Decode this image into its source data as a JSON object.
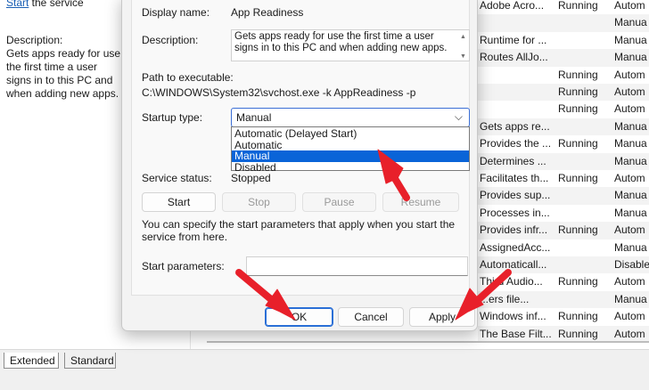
{
  "background": {
    "left_pane": {
      "start_link": "Start",
      "start_rest": " the service",
      "description_label": "Description:",
      "description_text": "Gets apps ready for use the first time a user signs in to this PC and when adding new apps."
    },
    "services_rows": [
      {
        "name": "Adobe Acro...",
        "status": "Running",
        "startup": "Autom"
      },
      {
        "name": "",
        "status": "",
        "startup": "Manua"
      },
      {
        "name": "Runtime for ...",
        "status": "",
        "startup": "Manua"
      },
      {
        "name": "Routes AllJo...",
        "status": "",
        "startup": "Manua"
      },
      {
        "name": "",
        "status": "Running",
        "startup": "Autom"
      },
      {
        "name": "",
        "status": "Running",
        "startup": "Autom"
      },
      {
        "name": "",
        "status": "Running",
        "startup": "Autom"
      },
      {
        "name": "Gets apps re...",
        "status": "",
        "startup": "Manua"
      },
      {
        "name": "Provides the ...",
        "status": "Running",
        "startup": "Manua"
      },
      {
        "name": "Determines ...",
        "status": "",
        "startup": "Manua"
      },
      {
        "name": "Facilitates th...",
        "status": "Running",
        "startup": "Autom"
      },
      {
        "name": "Provides sup...",
        "status": "",
        "startup": "Manua"
      },
      {
        "name": "Processes in...",
        "status": "",
        "startup": "Manua"
      },
      {
        "name": "Provides infr...",
        "status": "Running",
        "startup": "Autom"
      },
      {
        "name": "AssignedAcc...",
        "status": "",
        "startup": "Manua"
      },
      {
        "name": "Automaticall...",
        "status": "",
        "startup": "Disable"
      },
      {
        "name": "Third Audio...",
        "status": "Running",
        "startup": "Autom"
      },
      {
        "name": "...ers file...",
        "status": "",
        "startup": "Manua"
      },
      {
        "name": "Windows inf...",
        "status": "Running",
        "startup": "Autom"
      },
      {
        "name": "The Base Filt...",
        "status": "Running",
        "startup": "Autom"
      }
    ],
    "tabs": [
      "Extended",
      "Standard"
    ]
  },
  "dialog": {
    "display_name_label": "Display name:",
    "display_name_value": "App Readiness",
    "description_label": "Description:",
    "description_value": "Gets apps ready for use the first time a user signs in to this PC and when adding new apps.",
    "path_label": "Path to executable:",
    "path_value": "C:\\WINDOWS\\System32\\svchost.exe -k AppReadiness -p",
    "startup_type_label": "Startup type:",
    "startup_type_value": "Manual",
    "startup_options": [
      "Automatic (Delayed Start)",
      "Automatic",
      "Manual",
      "Disabled"
    ],
    "selected_option": "Manual",
    "service_status_label": "Service status:",
    "service_status_value": "Stopped",
    "buttons": {
      "start": "Start",
      "stop": "Stop",
      "pause": "Pause",
      "resume": "Resume"
    },
    "note": "You can specify the start parameters that apply when you start the service from here.",
    "start_parameters_label": "Start parameters:",
    "start_parameters_value": "",
    "footer": {
      "ok": "OK",
      "cancel": "Cancel",
      "apply": "Apply"
    }
  },
  "colors": {
    "accent": "#0a64d8",
    "annotation_arrow": "#e8202a",
    "dialog_bg": "#f3f3f3"
  }
}
